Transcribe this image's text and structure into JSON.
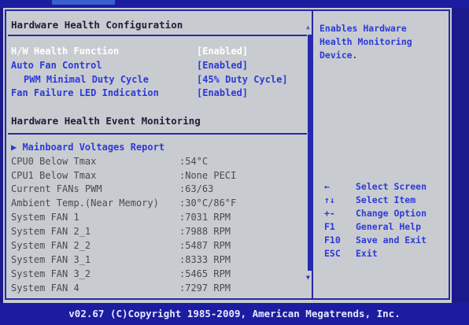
{
  "left_panel": {
    "section_title": "Hardware Health Configuration",
    "settings": [
      {
        "label": "H/W Health Function",
        "value": "[Enabled]"
      },
      {
        "label": "Auto Fan Control",
        "value": "[Enabled]"
      },
      {
        "label": "PWM Minimal Duty Cycle",
        "value": "[45% Duty Cycle]"
      },
      {
        "label": "Fan Failure LED Indication",
        "value": "[Enabled]"
      }
    ],
    "monitor_title": "Hardware Health Event Monitoring",
    "submenu": "Mainboard Voltages Report",
    "readings": [
      {
        "label": "CPU0 Below Tmax",
        "value": ":54°C"
      },
      {
        "label": "CPU1 Below Tmax",
        "value": ":None PECI"
      },
      {
        "label": "Current FANs PWM",
        "value": ":63/63"
      },
      {
        "label": "Ambient Temp.(Near Memory)",
        "value": ":30°C/86°F"
      },
      {
        "label": "System FAN 1",
        "value": ":7031 RPM"
      },
      {
        "label": "System FAN 2_1",
        "value": ":7988 RPM"
      },
      {
        "label": "System FAN 2_2",
        "value": ":5487 RPM"
      },
      {
        "label": "System FAN 3_1",
        "value": ":8333 RPM"
      },
      {
        "label": "System FAN 3_2",
        "value": ":5465 RPM"
      },
      {
        "label": "System FAN 4",
        "value": ":7297 RPM"
      }
    ]
  },
  "right_panel": {
    "help_lines": [
      "Enables Hardware",
      "Health Monitoring",
      "Device."
    ],
    "keys": [
      {
        "key": "←",
        "desc": "Select Screen"
      },
      {
        "key": "↑↓",
        "desc": "Select Item"
      },
      {
        "key": "+-",
        "desc": "Change Option"
      },
      {
        "key": "F1",
        "desc": "General Help"
      },
      {
        "key": "F10",
        "desc": "Save and Exit"
      },
      {
        "key": "ESC",
        "desc": "Exit"
      }
    ]
  },
  "footer": {
    "text": "v02.67 (C)Copyright 1985-2009, American Megatrends, Inc."
  },
  "colors": {
    "background": "#1a1a8c",
    "panel": "#c8ccd0",
    "accent_blue": "#2c3ad8",
    "selected_text": "#ffffff"
  }
}
